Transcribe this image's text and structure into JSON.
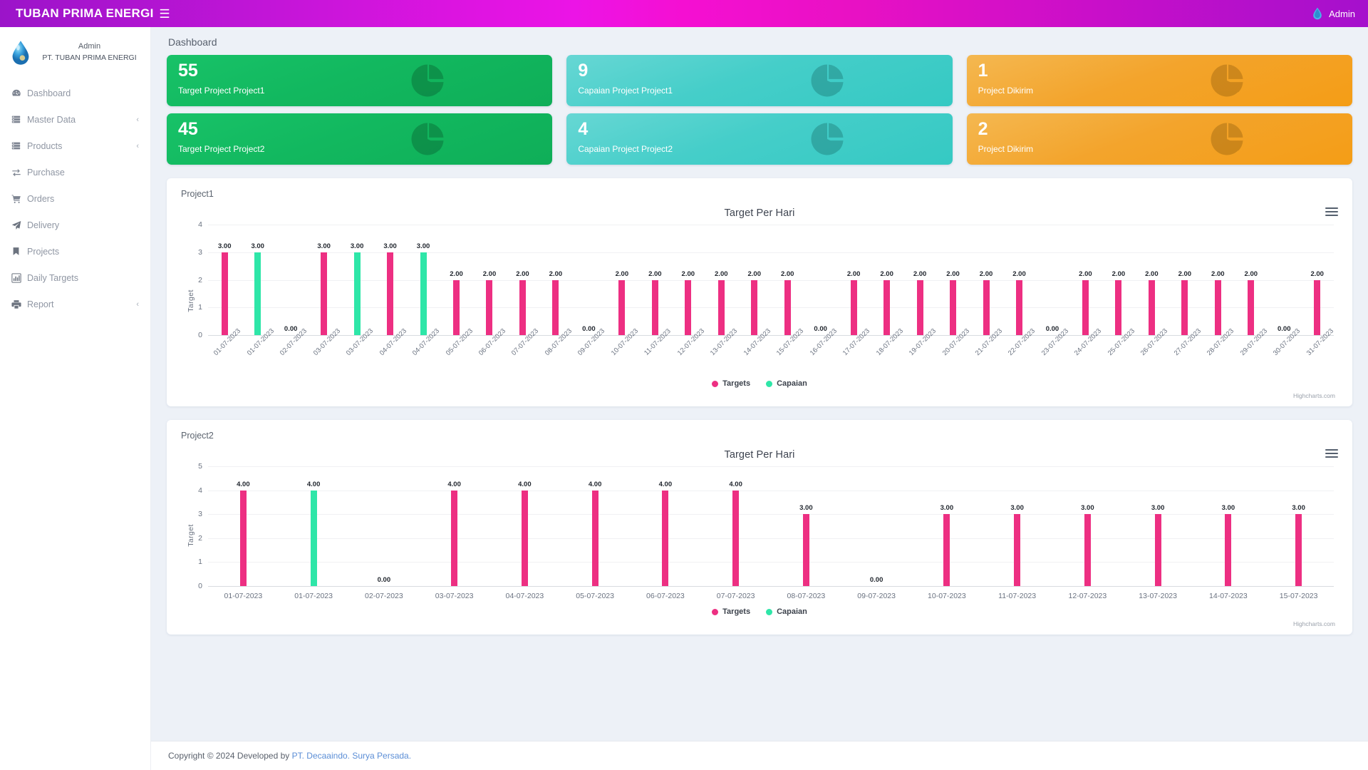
{
  "topbar": {
    "brand": "TUBAN PRIMA ENERGI",
    "menu_icon": "hamburger-icon",
    "user_label": "Admin"
  },
  "sidebar": {
    "profile": {
      "role": "Admin",
      "company": "PT. TUBAN PRIMA ENERGI"
    },
    "items": [
      {
        "label": "Dashboard",
        "icon": "dashboard-icon",
        "caret": ""
      },
      {
        "label": "Master Data",
        "icon": "database-icon",
        "caret": "‹"
      },
      {
        "label": "Products",
        "icon": "database-icon",
        "caret": "‹"
      },
      {
        "label": "Purchase",
        "icon": "exchange-icon",
        "caret": ""
      },
      {
        "label": "Orders",
        "icon": "cart-icon",
        "caret": ""
      },
      {
        "label": "Delivery",
        "icon": "paper-plane-icon",
        "caret": ""
      },
      {
        "label": "Projects",
        "icon": "bookmark-icon",
        "caret": ""
      },
      {
        "label": "Daily Targets",
        "icon": "bar-chart-icon",
        "caret": ""
      },
      {
        "label": "Report",
        "icon": "printer-icon",
        "caret": "‹"
      }
    ]
  },
  "page": {
    "title": "Dashboard"
  },
  "cards": [
    {
      "value": "55",
      "label": "Target Project Project1",
      "color": "green",
      "hex": "#12b85f"
    },
    {
      "value": "45",
      "label": "Target Project Project2",
      "color": "green",
      "hex": "#12b85f"
    },
    {
      "value": "9",
      "label": "Capaian Project Project1",
      "color": "teal",
      "hex": "#45cec9"
    },
    {
      "value": "4",
      "label": "Capaian Project Project2",
      "color": "teal",
      "hex": "#45cec9"
    },
    {
      "value": "1",
      "label": "Project Dikirim",
      "color": "orange",
      "hex": "#f3a42c"
    },
    {
      "value": "2",
      "label": "Project Dikirim",
      "color": "orange",
      "hex": "#f3a42c"
    }
  ],
  "panels": [
    {
      "label": "Project1",
      "credits": "Highcharts.com"
    },
    {
      "label": "Project2",
      "credits": "Highcharts.com"
    }
  ],
  "legend": [
    {
      "label": "Targets",
      "color": "#ed2f82"
    },
    {
      "label": "Capaian",
      "color": "#2ee6a8"
    }
  ],
  "footer": {
    "text": "Copyright © 2024 Developed by ",
    "link": "PT. Decaaindo. Surya Persada."
  },
  "chart_data": [
    {
      "type": "bar",
      "title": "Target Per Hari",
      "panel_label": "Project1",
      "xlabel": "",
      "ylabel": "Target",
      "ylim": [
        0,
        4
      ],
      "yticks": [
        0,
        1,
        2,
        3,
        4
      ],
      "grid": true,
      "legend_position": "bottom",
      "series_names": [
        "Targets",
        "Capaian"
      ],
      "colors": {
        "Targets": "#ed2f82",
        "Capaian": "#2ee6a8"
      },
      "categories": [
        "01-07-2023",
        "01-07-2023",
        "02-07-2023",
        "03-07-2023",
        "03-07-2023",
        "04-07-2023",
        "04-07-2023",
        "05-07-2023",
        "06-07-2023",
        "07-07-2023",
        "08-07-2023",
        "09-07-2023",
        "10-07-2023",
        "11-07-2023",
        "12-07-2023",
        "13-07-2023",
        "14-07-2023",
        "15-07-2023",
        "16-07-2023",
        "17-07-2023",
        "18-07-2023",
        "19-07-2023",
        "20-07-2023",
        "21-07-2023",
        "22-07-2023",
        "23-07-2023",
        "24-07-2023",
        "25-07-2023",
        "26-07-2023",
        "27-07-2023",
        "28-07-2023",
        "29-07-2023",
        "30-07-2023",
        "31-07-2023"
      ],
      "bars": [
        {
          "value": 3,
          "series": "Targets"
        },
        {
          "value": 3,
          "series": "Capaian"
        },
        {
          "value": 0,
          "series": "Targets"
        },
        {
          "value": 3,
          "series": "Targets"
        },
        {
          "value": 3,
          "series": "Capaian"
        },
        {
          "value": 3,
          "series": "Targets"
        },
        {
          "value": 3,
          "series": "Capaian"
        },
        {
          "value": 2,
          "series": "Targets"
        },
        {
          "value": 2,
          "series": "Targets"
        },
        {
          "value": 2,
          "series": "Targets"
        },
        {
          "value": 2,
          "series": "Targets"
        },
        {
          "value": 0,
          "series": "Targets"
        },
        {
          "value": 2,
          "series": "Targets"
        },
        {
          "value": 2,
          "series": "Targets"
        },
        {
          "value": 2,
          "series": "Targets"
        },
        {
          "value": 2,
          "series": "Targets"
        },
        {
          "value": 2,
          "series": "Targets"
        },
        {
          "value": 2,
          "series": "Targets"
        },
        {
          "value": 0,
          "series": "Targets"
        },
        {
          "value": 2,
          "series": "Targets"
        },
        {
          "value": 2,
          "series": "Targets"
        },
        {
          "value": 2,
          "series": "Targets"
        },
        {
          "value": 2,
          "series": "Targets"
        },
        {
          "value": 2,
          "series": "Targets"
        },
        {
          "value": 2,
          "series": "Targets"
        },
        {
          "value": 0,
          "series": "Targets"
        },
        {
          "value": 2,
          "series": "Targets"
        },
        {
          "value": 2,
          "series": "Targets"
        },
        {
          "value": 2,
          "series": "Targets"
        },
        {
          "value": 2,
          "series": "Targets"
        },
        {
          "value": 2,
          "series": "Targets"
        },
        {
          "value": 2,
          "series": "Targets"
        },
        {
          "value": 0,
          "series": "Targets"
        },
        {
          "value": 2,
          "series": "Targets"
        }
      ]
    },
    {
      "type": "bar",
      "title": "Target Per Hari",
      "panel_label": "Project2",
      "xlabel": "",
      "ylabel": "Target",
      "ylim": [
        0,
        5
      ],
      "yticks": [
        0,
        1,
        2,
        3,
        4,
        5
      ],
      "grid": true,
      "legend_position": "bottom",
      "series_names": [
        "Targets",
        "Capaian"
      ],
      "colors": {
        "Targets": "#ed2f82",
        "Capaian": "#2ee6a8"
      },
      "categories": [
        "01-07-2023",
        "01-07-2023",
        "02-07-2023",
        "03-07-2023",
        "04-07-2023",
        "05-07-2023",
        "06-07-2023",
        "07-07-2023",
        "08-07-2023",
        "09-07-2023",
        "10-07-2023",
        "11-07-2023",
        "12-07-2023",
        "13-07-2023",
        "14-07-2023",
        "15-07-2023"
      ],
      "bars": [
        {
          "value": 4,
          "series": "Targets"
        },
        {
          "value": 4,
          "series": "Capaian"
        },
        {
          "value": 0,
          "series": "Targets"
        },
        {
          "value": 4,
          "series": "Targets"
        },
        {
          "value": 4,
          "series": "Targets"
        },
        {
          "value": 4,
          "series": "Targets"
        },
        {
          "value": 4,
          "series": "Targets"
        },
        {
          "value": 4,
          "series": "Targets"
        },
        {
          "value": 3,
          "series": "Targets"
        },
        {
          "value": 0,
          "series": "Targets"
        },
        {
          "value": 3,
          "series": "Targets"
        },
        {
          "value": 3,
          "series": "Targets"
        },
        {
          "value": 3,
          "series": "Targets"
        },
        {
          "value": 3,
          "series": "Targets"
        },
        {
          "value": 3,
          "series": "Targets"
        },
        {
          "value": 3,
          "series": "Targets"
        }
      ]
    }
  ]
}
